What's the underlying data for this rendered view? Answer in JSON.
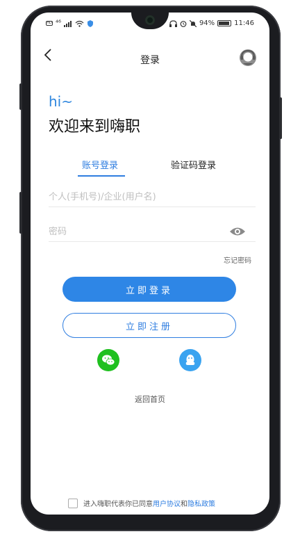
{
  "status_bar": {
    "left_badge": "HD",
    "signal_text": "⁴⁶",
    "battery_percent": "94%",
    "time": "11:46"
  },
  "nav": {
    "title": "登录"
  },
  "greeting": {
    "hi": "hi~",
    "welcome": "欢迎来到嗨职"
  },
  "tabs": {
    "account_login": "账号登录",
    "code_login": "验证码登录",
    "active": "account_login"
  },
  "form": {
    "username_placeholder": "个人(手机号)/企业(用户名)",
    "password_placeholder": "密码",
    "forgot_password": "忘记密码"
  },
  "buttons": {
    "login": "立即登录",
    "register": "立即注册"
  },
  "social": {
    "wechat": "wechat-icon",
    "qq": "qq-icon"
  },
  "links": {
    "home": "返回首页"
  },
  "agreement": {
    "prefix": "进入嗨职代表你已同意",
    "user_agreement": "用户协议",
    "and": "和",
    "privacy_policy": "隐私政策"
  },
  "colors": {
    "primary": "#2e86e6",
    "wechat": "#1fc01f",
    "qq": "#3aa3f0"
  }
}
